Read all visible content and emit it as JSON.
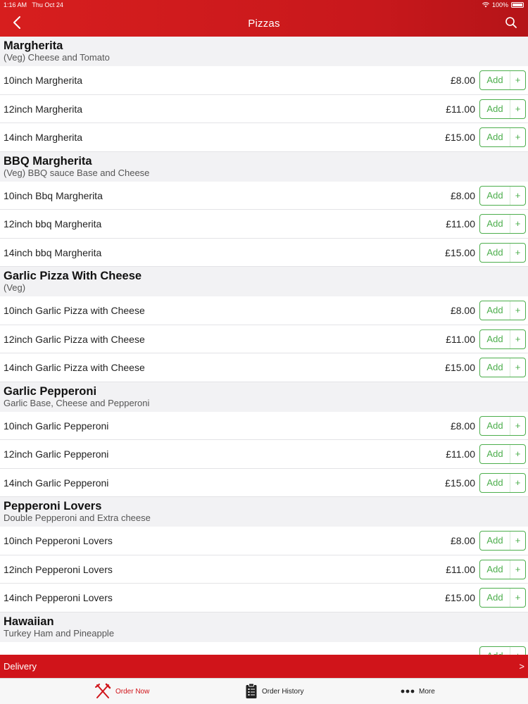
{
  "status": {
    "time": "1:16 AM",
    "date": "Thu Oct 24",
    "battery": "100%"
  },
  "header": {
    "title": "Pizzas"
  },
  "sections": [
    {
      "name": "Margherita",
      "desc": "(Veg) Cheese and Tomato",
      "items": [
        {
          "name": "10inch Margherita",
          "price": "£8.00"
        },
        {
          "name": "12inch Margherita",
          "price": "£11.00"
        },
        {
          "name": "14inch Margherita",
          "price": "£15.00"
        }
      ]
    },
    {
      "name": "BBQ Margherita",
      "desc": "(Veg) BBQ sauce Base and Cheese",
      "items": [
        {
          "name": "10inch Bbq Margherita",
          "price": "£8.00"
        },
        {
          "name": "12inch bbq Margherita",
          "price": "£11.00"
        },
        {
          "name": "14inch bbq Margherita",
          "price": "£15.00"
        }
      ]
    },
    {
      "name": "Garlic Pizza With Cheese",
      "desc": "(Veg)",
      "items": [
        {
          "name": "10inch Garlic Pizza with Cheese",
          "price": "£8.00"
        },
        {
          "name": "12inch Garlic Pizza with Cheese",
          "price": "£11.00"
        },
        {
          "name": "14inch Garlic Pizza with Cheese",
          "price": "£15.00"
        }
      ]
    },
    {
      "name": "Garlic Pepperoni",
      "desc": "Garlic Base, Cheese and Pepperoni",
      "items": [
        {
          "name": "10inch Garlic Pepperoni",
          "price": "£8.00"
        },
        {
          "name": "12inch Garlic Pepperoni",
          "price": "£11.00"
        },
        {
          "name": "14inch Garlic Pepperoni",
          "price": "£15.00"
        }
      ]
    },
    {
      "name": "Pepperoni Lovers",
      "desc": "Double Pepperoni and Extra cheese",
      "items": [
        {
          "name": "10inch Pepperoni Lovers",
          "price": "£8.00"
        },
        {
          "name": "12inch Pepperoni Lovers",
          "price": "£11.00"
        },
        {
          "name": "14inch Pepperoni Lovers",
          "price": "£15.00"
        }
      ]
    },
    {
      "name": "Hawaiian",
      "desc": "Turkey Ham and Pineapple",
      "items": [
        {
          "name": "",
          "price": ""
        }
      ]
    }
  ],
  "add_button": {
    "label": "Add",
    "plus": "+"
  },
  "delivery": {
    "label": "Delivery",
    "arrow": ">"
  },
  "tabs": {
    "order_now": "Order Now",
    "order_history": "Order History",
    "more": "More"
  },
  "colors": {
    "brand_red": "#d0141a",
    "add_green": "#4cae4c"
  },
  "icons": [
    "chevron-left-icon",
    "search-icon",
    "fork-knife-icon",
    "clipboard-icon",
    "ellipsis-icon"
  ]
}
